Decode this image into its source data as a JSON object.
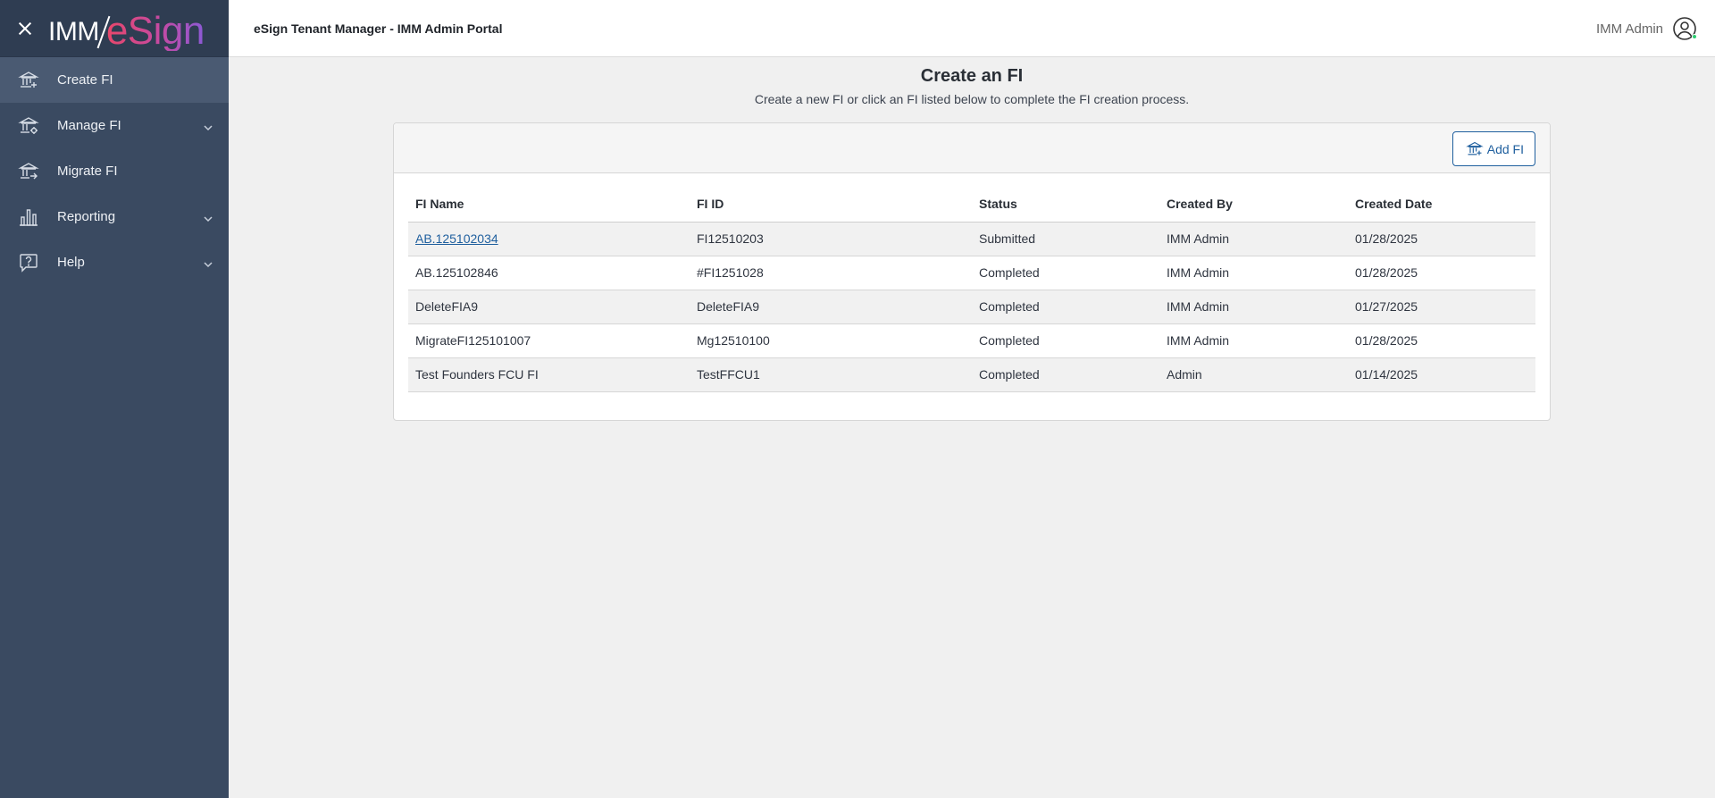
{
  "sidebar": {
    "logo": {
      "left": "IMM",
      "right": "eSign"
    },
    "items": [
      {
        "label": "Create FI",
        "icon": "bank-add-icon",
        "active": true,
        "expandable": false
      },
      {
        "label": "Manage FI",
        "icon": "bank-settings-icon",
        "active": false,
        "expandable": true
      },
      {
        "label": "Migrate FI",
        "icon": "bank-migrate-icon",
        "active": false,
        "expandable": false
      },
      {
        "label": "Reporting",
        "icon": "bar-chart-icon",
        "active": false,
        "expandable": true
      },
      {
        "label": "Help",
        "icon": "help-bubble-icon",
        "active": false,
        "expandable": true
      }
    ]
  },
  "header": {
    "title": "eSign Tenant Manager - IMM Admin Portal",
    "user_name": "IMM Admin"
  },
  "main": {
    "title": "Create an FI",
    "subtitle": "Create a new FI or click an FI listed below to complete the FI creation process.",
    "add_button_label": "Add FI",
    "table": {
      "columns": [
        "FI Name",
        "FI ID",
        "Status",
        "Created By",
        "Created Date"
      ],
      "rows": [
        {
          "name": "AB.125102034",
          "id": "FI12510203",
          "status": "Submitted",
          "created_by": "IMM Admin",
          "created_date": "01/28/2025",
          "link": true
        },
        {
          "name": "AB.125102846",
          "id": "#FI1251028",
          "status": "Completed",
          "created_by": "IMM Admin",
          "created_date": "01/28/2025",
          "link": false
        },
        {
          "name": "DeleteFIA9",
          "id": "DeleteFIA9",
          "status": "Completed",
          "created_by": "IMM Admin",
          "created_date": "01/27/2025",
          "link": false
        },
        {
          "name": "MigrateFI125101007",
          "id": "Mg12510100",
          "status": "Completed",
          "created_by": "IMM Admin",
          "created_date": "01/28/2025",
          "link": false
        },
        {
          "name": "Test Founders FCU FI",
          "id": "TestFFCU1",
          "status": "Completed",
          "created_by": "Admin",
          "created_date": "01/14/2025",
          "link": false
        }
      ]
    }
  },
  "colors": {
    "sidebar_bg": "#3a4a61",
    "sidebar_header_bg": "#2f3d52",
    "accent_link": "#1f5f9e",
    "online": "#2ecc71"
  }
}
